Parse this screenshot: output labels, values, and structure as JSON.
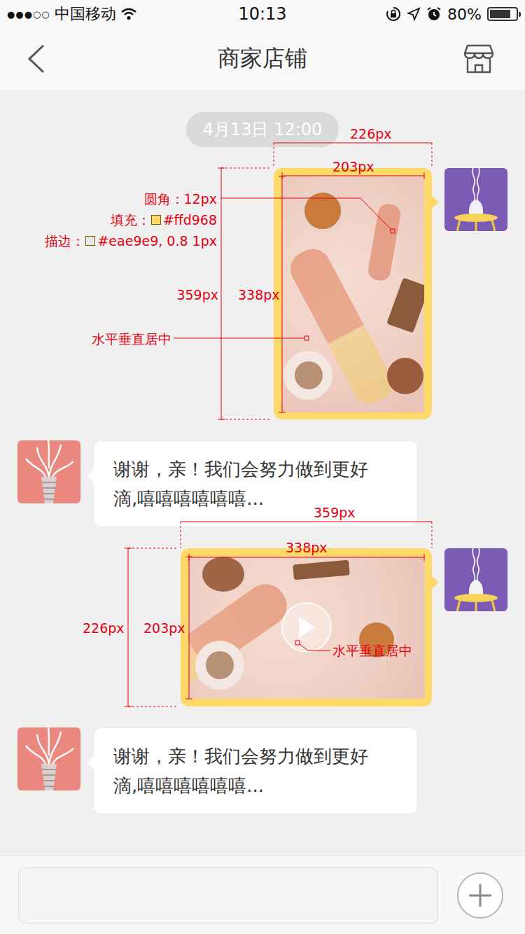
{
  "status_bar": {
    "signal": "●●●○○",
    "carrier": "中国移动",
    "time": "10:13",
    "battery": "80%",
    "battery_level": 0.8
  },
  "nav": {
    "title": "商家店铺"
  },
  "messages": [
    {
      "kind": "timestamp",
      "text": "4月13日 12:00"
    },
    {
      "kind": "image",
      "sender": "me"
    },
    {
      "kind": "text",
      "sender": "shop",
      "lines": [
        "谢谢，亲！我们会努力做到更好",
        "滴,嘻嘻嘻嘻嘻嘻..."
      ]
    },
    {
      "kind": "video",
      "sender": "me"
    },
    {
      "kind": "text",
      "sender": "shop",
      "lines": [
        "谢谢，亲！我们会努力做到更好",
        "滴,嘻嘻嘻嘻嘻嘻..."
      ]
    }
  ],
  "annotations": {
    "image": {
      "outer_width": "226px",
      "inner_width": "203px",
      "outer_height": "359px",
      "inner_height": "338px",
      "radius_label": "圆角：12px",
      "fill_label": "填充：",
      "fill_value": "#ffd968",
      "stroke_label": "描边：",
      "stroke_value": "#eae9e9, 0.8 1px",
      "center_label": "水平垂直居中"
    },
    "video": {
      "outer_width": "359px",
      "inner_width": "338px",
      "outer_height": "226px",
      "inner_height": "203px",
      "center_label": "水平垂直居中"
    }
  }
}
